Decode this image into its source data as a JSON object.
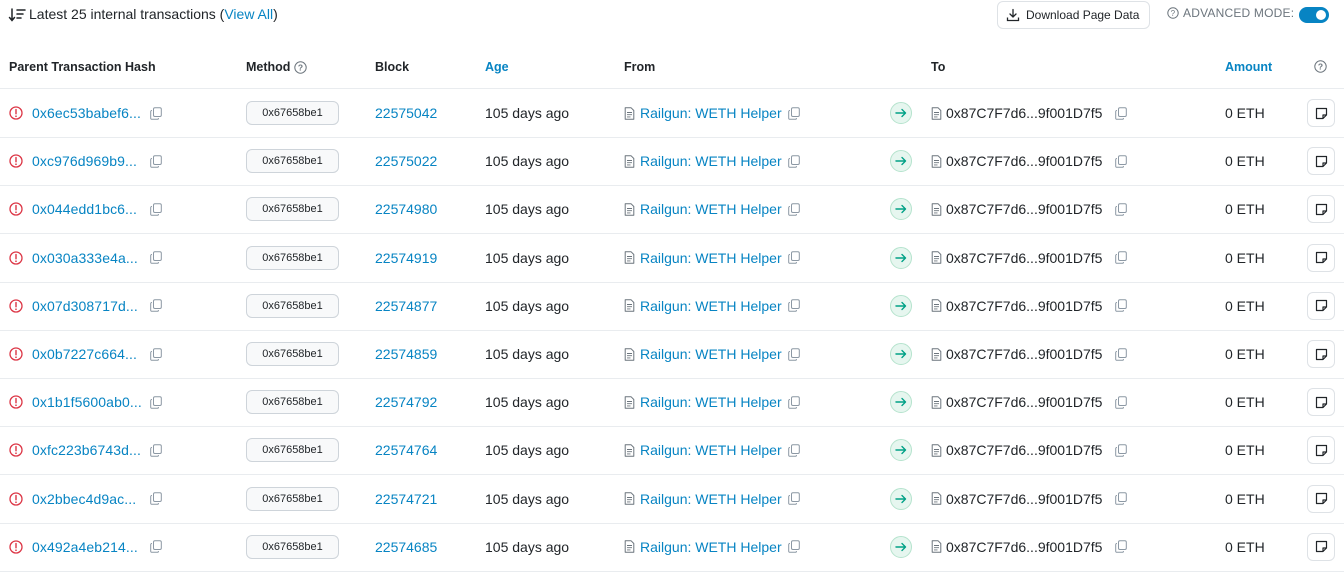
{
  "header": {
    "summary_prefix": "Latest 25 internal transactions (",
    "view_all": "View All",
    "summary_suffix": ")",
    "download_label": "Download Page Data",
    "advanced_mode_label": "ADVANCED MODE:",
    "advanced_mode_on": true
  },
  "columns": {
    "hash": "Parent Transaction Hash",
    "method": "Method",
    "block": "Block",
    "age": "Age",
    "from": "From",
    "to": "To",
    "amount": "Amount"
  },
  "colors": {
    "link": "#0784c3",
    "error": "#dc3545",
    "arrow_bg": "#e6f6ef",
    "arrow_fg": "#00a186"
  },
  "rows": [
    {
      "hash": "0x6ec53babef6...",
      "method": "0x67658be1",
      "block": "22575042",
      "age": "105 days ago",
      "from": "Railgun: WETH Helper",
      "to": "0x87C7F7d6...9f001D7f5",
      "amount": "0 ETH"
    },
    {
      "hash": "0xc976d969b9...",
      "method": "0x67658be1",
      "block": "22575022",
      "age": "105 days ago",
      "from": "Railgun: WETH Helper",
      "to": "0x87C7F7d6...9f001D7f5",
      "amount": "0 ETH"
    },
    {
      "hash": "0x044edd1bc6...",
      "method": "0x67658be1",
      "block": "22574980",
      "age": "105 days ago",
      "from": "Railgun: WETH Helper",
      "to": "0x87C7F7d6...9f001D7f5",
      "amount": "0 ETH"
    },
    {
      "hash": "0x030a333e4a...",
      "method": "0x67658be1",
      "block": "22574919",
      "age": "105 days ago",
      "from": "Railgun: WETH Helper",
      "to": "0x87C7F7d6...9f001D7f5",
      "amount": "0 ETH"
    },
    {
      "hash": "0x07d308717d...",
      "method": "0x67658be1",
      "block": "22574877",
      "age": "105 days ago",
      "from": "Railgun: WETH Helper",
      "to": "0x87C7F7d6...9f001D7f5",
      "amount": "0 ETH"
    },
    {
      "hash": "0x0b7227c664...",
      "method": "0x67658be1",
      "block": "22574859",
      "age": "105 days ago",
      "from": "Railgun: WETH Helper",
      "to": "0x87C7F7d6...9f001D7f5",
      "amount": "0 ETH"
    },
    {
      "hash": "0x1b1f5600ab0...",
      "method": "0x67658be1",
      "block": "22574792",
      "age": "105 days ago",
      "from": "Railgun: WETH Helper",
      "to": "0x87C7F7d6...9f001D7f5",
      "amount": "0 ETH"
    },
    {
      "hash": "0xfc223b6743d...",
      "method": "0x67658be1",
      "block": "22574764",
      "age": "105 days ago",
      "from": "Railgun: WETH Helper",
      "to": "0x87C7F7d6...9f001D7f5",
      "amount": "0 ETH"
    },
    {
      "hash": "0x2bbec4d9ac...",
      "method": "0x67658be1",
      "block": "22574721",
      "age": "105 days ago",
      "from": "Railgun: WETH Helper",
      "to": "0x87C7F7d6...9f001D7f5",
      "amount": "0 ETH"
    },
    {
      "hash": "0x492a4eb214...",
      "method": "0x67658be1",
      "block": "22574685",
      "age": "105 days ago",
      "from": "Railgun: WETH Helper",
      "to": "0x87C7F7d6...9f001D7f5",
      "amount": "0 ETH"
    }
  ]
}
